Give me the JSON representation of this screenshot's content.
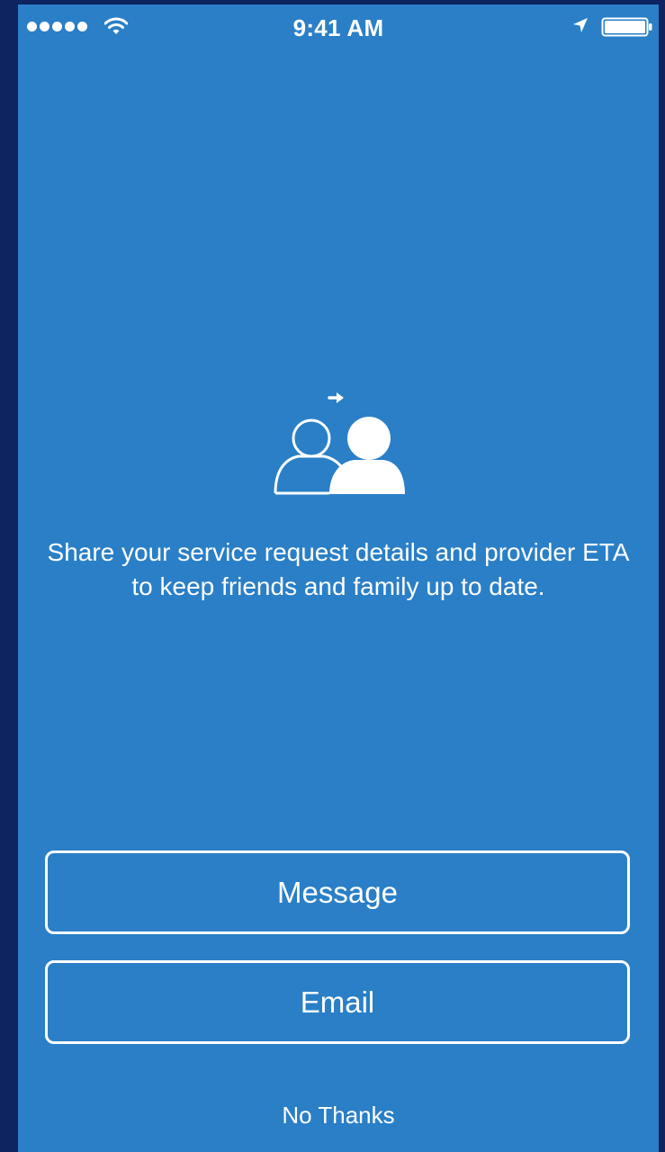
{
  "status_bar": {
    "time": "9:41 AM",
    "signal_icon": "signal-dots-icon",
    "wifi_icon": "wifi-icon",
    "location_icon": "location-arrow-icon",
    "battery_icon": "battery-icon"
  },
  "illustration": {
    "icon": "share-people-icon"
  },
  "description": "Share your service request details and provider ETA to keep friends and family up to date.",
  "buttons": {
    "message": "Message",
    "email": "Email"
  },
  "no_thanks": "No Thanks",
  "colors": {
    "screen_background": "#2a7fc7",
    "frame_background": "#0d2461",
    "foreground": "#ffffff"
  }
}
